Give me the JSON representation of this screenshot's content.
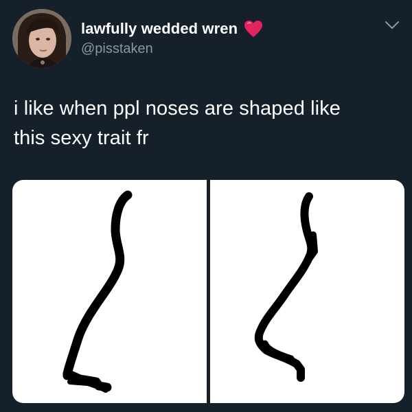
{
  "tweet": {
    "display_name": "lawfully wedded wren",
    "name_emoji": "heart-icon",
    "handle": "@pisstaken",
    "text_line_1": "i like when ppl noses are shaped like",
    "text_line_2": "this sexy trait fr"
  },
  "icons": {
    "avatar": "avatar",
    "menu": "chevron-down-icon"
  },
  "colors": {
    "background": "#15202b",
    "name": "#ffffff",
    "handle": "#8899a6",
    "heart": "#e0245e",
    "chevron": "#8899a6"
  }
}
